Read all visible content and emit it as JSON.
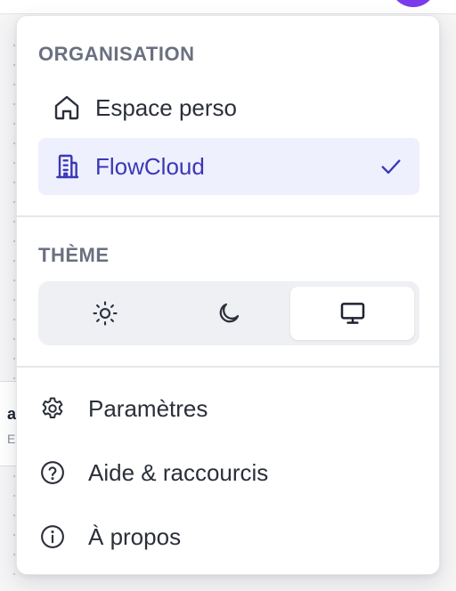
{
  "colors": {
    "accent": "#3b37b8",
    "active_bg": "#eef0fd",
    "muted_text": "#6b7080",
    "avatar": "#7c3aed"
  },
  "menu": {
    "organisation": {
      "label": "ORGANISATION",
      "items": [
        {
          "label": "Espace perso",
          "icon": "home-icon",
          "selected": false
        },
        {
          "label": "FlowCloud",
          "icon": "building-icon",
          "selected": true
        }
      ]
    },
    "theme": {
      "label": "THÈME",
      "options": [
        {
          "name": "light",
          "icon": "sun-icon",
          "selected": false
        },
        {
          "name": "dark",
          "icon": "moon-icon",
          "selected": false
        },
        {
          "name": "system",
          "icon": "monitor-icon",
          "selected": true
        }
      ]
    },
    "actions": [
      {
        "label": "Paramètres",
        "icon": "gear-icon"
      },
      {
        "label": "Aide & raccourcis",
        "icon": "help-circle-icon"
      },
      {
        "label": "À propos",
        "icon": "info-icon"
      }
    ]
  },
  "background": {
    "card_line1": "a",
    "card_line2": "E"
  }
}
